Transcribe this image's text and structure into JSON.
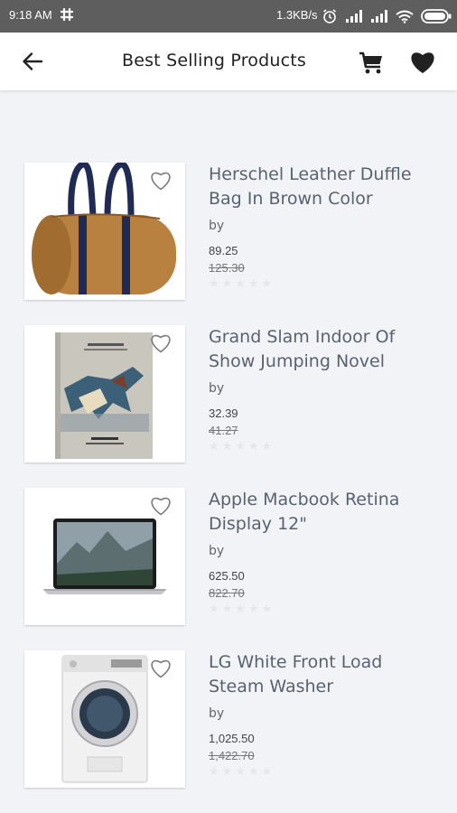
{
  "status_bar": {
    "time": "9:18 AM",
    "network_speed": "1.3KB/s",
    "icons": [
      "slack-icon",
      "alarm-icon",
      "signal-icon",
      "signal-icon",
      "wifi-icon",
      "battery-icon"
    ]
  },
  "header": {
    "title": "Best Selling Products",
    "back_icon": "arrow-left-icon",
    "cart_icon": "cart-icon",
    "wishlist_icon": "heart-icon"
  },
  "products": [
    {
      "name": "Herschel Leather Duffle Bag In Brown Color",
      "by_label": "by",
      "price": "89.25",
      "old_price": "125.30",
      "rating": 0,
      "image": "brown-duffle-bag"
    },
    {
      "name": "Grand Slam Indoor Of Show Jumping Novel",
      "by_label": "by",
      "price": "32.39",
      "old_price": "41.27",
      "rating": 0,
      "image": "book-cover-horse"
    },
    {
      "name": "Apple Macbook Retina Display 12\"",
      "by_label": "by",
      "price": "625.50",
      "old_price": "822.70",
      "rating": 0,
      "image": "macbook-laptop"
    },
    {
      "name": "LG White Front Load Steam Washer",
      "by_label": "by",
      "price": "1,025.50",
      "old_price": "1,422.70",
      "rating": 0,
      "image": "washing-machine"
    }
  ],
  "colors": {
    "accent": "#212121",
    "status_bar": "#5e5e5e",
    "background": "#f2f3f6",
    "product_name": "#5a6270"
  }
}
